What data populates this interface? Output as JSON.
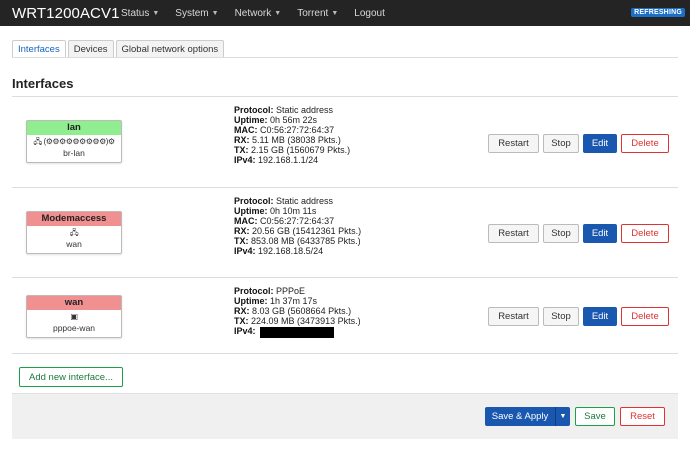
{
  "app": {
    "brand": "WRT1200ACV1",
    "status_badge": "REFRESHING"
  },
  "nav": [
    {
      "label": "Status",
      "has_dropdown": true
    },
    {
      "label": "System",
      "has_dropdown": true
    },
    {
      "label": "Network",
      "has_dropdown": true
    },
    {
      "label": "Torrent",
      "has_dropdown": true
    },
    {
      "label": "Logout",
      "has_dropdown": false
    }
  ],
  "tabs": [
    {
      "label": "Interfaces",
      "active": true
    },
    {
      "label": "Devices",
      "active": false
    },
    {
      "label": "Global network options",
      "active": false
    }
  ],
  "page_title": "Interfaces",
  "labels": {
    "protocol": "Protocol:",
    "uptime": "Uptime:",
    "mac": "MAC:",
    "rx": "RX:",
    "tx": "TX:",
    "ipv4": "IPv4:"
  },
  "buttons": {
    "restart": "Restart",
    "stop": "Stop",
    "edit": "Edit",
    "delete": "Delete"
  },
  "interfaces": [
    {
      "name": "lan",
      "color": "#90ee90",
      "device_glyph": "🖧 (⚙⚙⚙⚙⚙⚙⚙⚙⚙)⚙",
      "device": "br-lan",
      "protocol": "Static address",
      "uptime": "0h 56m 22s",
      "mac": "C0:56:27:72:64:37",
      "rx": "5.11 MB (38038 Pkts.)",
      "tx": "2.15 GB (1560679 Pkts.)",
      "ipv4": "192.168.1.1/24"
    },
    {
      "name": "Modemaccess",
      "color": "#f09090",
      "device_glyph": "🖧",
      "device": "wan",
      "protocol": "Static address",
      "uptime": "0h 10m 11s",
      "mac": "C0:56:27:72:64:37",
      "rx": "20.56 GB (15412361 Pkts.)",
      "tx": "853.08 MB (6433785 Pkts.)",
      "ipv4": "192.168.18.5/24"
    },
    {
      "name": "wan",
      "color": "#f09090",
      "device_glyph": "▣",
      "device": "pppoe-wan",
      "protocol": "PPPoE",
      "uptime": "1h 37m 17s",
      "rx": "8.03 GB (5608664 Pkts.)",
      "tx": "224.09 MB (3473913 Pkts.)"
    }
  ],
  "add_interface": "Add new interface...",
  "footer": {
    "save_apply": "Save & Apply",
    "save": "Save",
    "reset": "Reset"
  }
}
